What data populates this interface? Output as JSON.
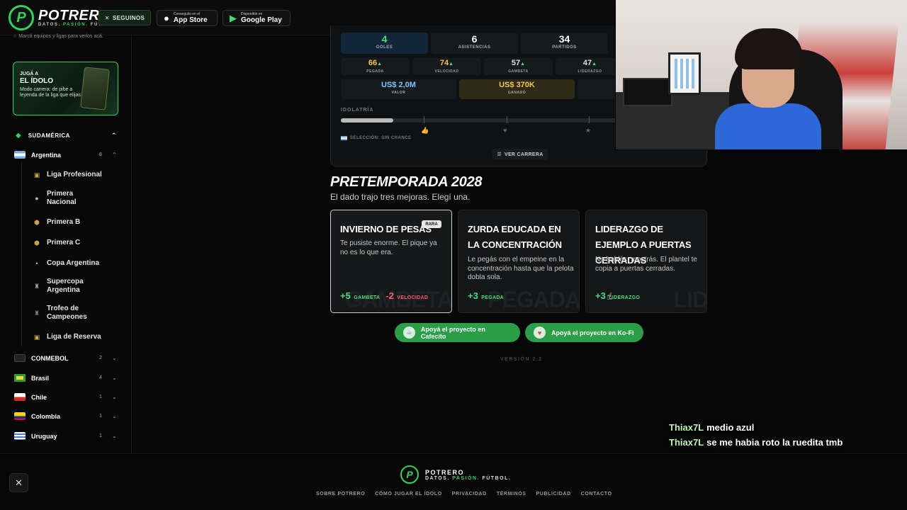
{
  "topbar": {
    "logo_name": "POTRERO",
    "logo_tag_1": "DATOS. ",
    "logo_tag_2": "PASIÓN.",
    "logo_tag_3": " FÚTBOL.",
    "follow_label": "SEGUINOS",
    "appstore_small": "Conseguilo en el",
    "appstore_big": "App Store",
    "play_small": "Disponible en",
    "play_big": "Google Play"
  },
  "sidebar": {
    "hint": "Marcá equipos y ligas para verlos acá.",
    "promo": {
      "kicker": "JUGÁ A",
      "title": "EL ÍDOLO",
      "desc": "Modo carrera: de pibe a leyenda de la liga que elijas"
    },
    "section": "SUDAMÉRICA",
    "argentina": {
      "label": "Argentina",
      "count": "8"
    },
    "leagues": [
      "Liga Profesional",
      "Primera Nacional",
      "Primera B",
      "Primera C",
      "Copa Argentina",
      "Supercopa Argentina",
      "Trofeo de Campeones",
      "Liga de Reserva"
    ],
    "others": [
      {
        "label": "CONMEBOL",
        "count": "2"
      },
      {
        "label": "Brasil",
        "count": "4"
      },
      {
        "label": "Chile",
        "count": "1"
      },
      {
        "label": "Colombia",
        "count": "1"
      },
      {
        "label": "Uruguay",
        "count": "1"
      }
    ]
  },
  "career": {
    "stats": [
      {
        "value": "4",
        "label": "GOLES"
      },
      {
        "value": "6",
        "label": "ASISTENCIAS"
      },
      {
        "value": "34",
        "label": "PARTIDOS"
      }
    ],
    "attrs": [
      {
        "value": "66",
        "label": "PEGADA"
      },
      {
        "value": "74",
        "label": "VELOCIDAD"
      },
      {
        "value": "57",
        "label": "GAMBETA"
      },
      {
        "value": "47",
        "label": "LIDERAZGO"
      }
    ],
    "money": [
      {
        "value": "US$ 2,0M",
        "label": "VALOR"
      },
      {
        "value": "US$ 370K",
        "label": "GANADO"
      }
    ],
    "idolatria_label": "IDOLATRÍA",
    "idolatria_progress": 0.19,
    "selection": "SELECCIÓN: SIN CHANCE",
    "ver_carrera": "VER CARRERA"
  },
  "pretemporada": {
    "title": "PRETEMPORADA 2028",
    "subtitle": "El dado trajo tres mejoras. Elegí una.",
    "choices": [
      {
        "title": "Invierno de pesas",
        "badge": "RARA",
        "desc": "Te pusiste enorme. El pique ya no es lo que era.",
        "fx1_n": "+5",
        "fx1_t": "GAMBETA",
        "fx2_n": "-2",
        "fx2_t": "VELOCIDAD",
        "ghost": "GAMBETA"
      },
      {
        "title": "Zurda educada en la concentración",
        "desc": "Le pegás con el empeine en la concentración hasta que la pelota dobla sola.",
        "fx1_n": "+3",
        "fx1_t": "PEGADA",
        "ghost": "PEGADA"
      },
      {
        "title": "Liderazgo de ejemplo a puertas cerradas",
        "desc": "No hablás: mostrás. El plantel te copia a puertas cerradas.",
        "fx1_n": "+3",
        "fx1_t": "LIDERAZGO",
        "ghost": "LID"
      }
    ],
    "cafecito": "Apoyá el proyecto en Cafecito",
    "kofi": "Apoyá el proyecto en Ko-Fi",
    "version": "VERSIÓN 2.2"
  },
  "footer": {
    "name": "POTRERO",
    "tag_1": "DATOS. ",
    "tag_2": "PASIÓN.",
    "tag_3": " FÚTBOL.",
    "links": [
      "SOBRE POTRERO",
      "CÓMO JUGAR EL ÍDOLO",
      "PRIVACIDAD",
      "TÉRMINOS",
      "PUBLICIDAD",
      "CONTACTO"
    ]
  },
  "chat": [
    {
      "user": "Thiax7L",
      "msg": "medio azul"
    },
    {
      "user": "Thiax7L",
      "msg": "se me habia roto la ruedita tmb"
    }
  ],
  "colors": {
    "brand_green": "#2bd65a",
    "gold": "#f3c64a",
    "red": "#ff5d6c"
  }
}
